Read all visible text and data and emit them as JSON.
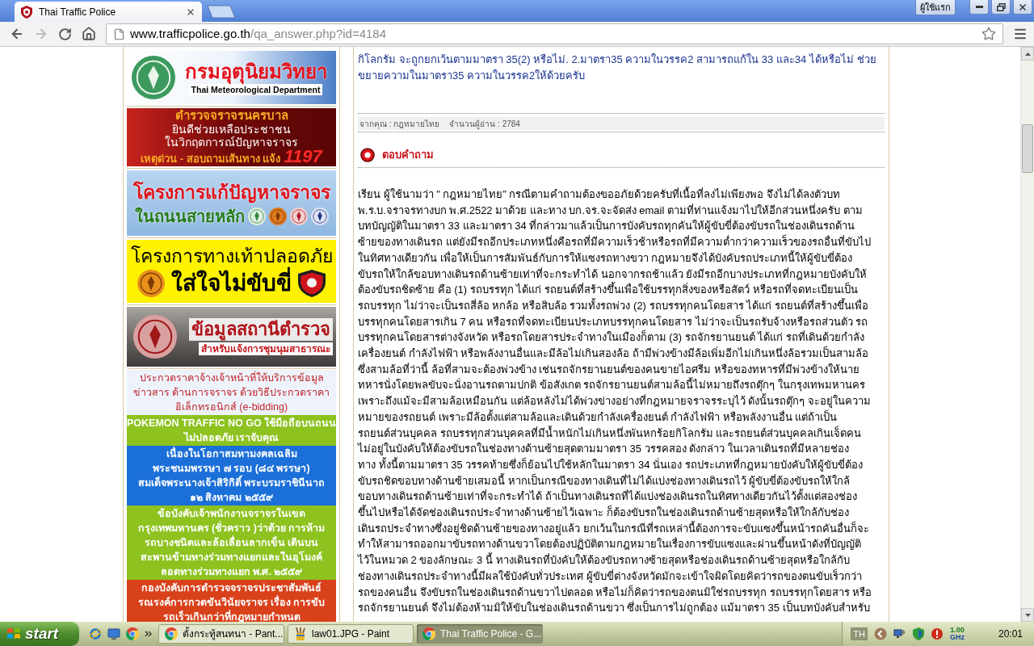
{
  "browser": {
    "tab_title": "Thai Traffic Police",
    "profile": "ผู้ใช้แรก",
    "url_host": "www.trafficpolice.go.th",
    "url_path": "/qa_answer.php?id=4184"
  },
  "sidebar": {
    "banners": [
      {
        "kind": "meteorology",
        "title": "กรมอุตุนิยมวิทยา",
        "subtitle": "Thai Meteorological Department"
      },
      {
        "kind": "hotline",
        "title": "ตำรวจจราจรนครบาล",
        "lines": [
          "ยินดีช่วยเหลือประชาชน",
          "ในวิกฤตการณ์ปัญหาจราจร"
        ],
        "call": "เหตุด่วน - สอบถามเส้นทาง แจ้ง",
        "number": "1197"
      },
      {
        "kind": "roads",
        "title": "โครงการแก้ปัญหาจราจร",
        "subtitle": "ในถนนสายหลัก"
      },
      {
        "kind": "sidewalk",
        "title": "โครงการทางเท้าปลอดภัย",
        "subtitle": "ใส่ใจไม่ขับขี่"
      },
      {
        "kind": "stations",
        "title": "ข้อมูลสถานีตำรวจ",
        "subtitle": "สำหรับแจ้งการชุมนุมสาธารณะ"
      }
    ],
    "links": [
      {
        "kind": "light",
        "color": "#eef3fb",
        "lines": [
          "ประกวดราคาจ้างเจ้าหน้าที่ให้บริการข้อมูล",
          "ข่าวสาร ด้านการจราจร ด้วยวิธีประกวดราคา",
          "อิเล็กทรอนิกส์ (e-bidding)"
        ]
      },
      {
        "kind": "solid",
        "color": "#8dc21f",
        "lines": [
          "POKEMON TRAFFIC NO GO ใช้มือถือบนถนน",
          "ไม่ปลอดภัย เราจับคุณ"
        ]
      },
      {
        "kind": "solid",
        "color": "#1b6fd8",
        "lines": [
          "เนื่องในโอกาสมหามงคลเฉลิม",
          "พระชนมพรรษา ๗ รอบ (๘๔ พรรษา)",
          "สมเด็จพระนางเจ้าสิริกิติ์ พระบรมราชินีนาถ",
          "๑๒ สิงหาคม ๒๕๕๙"
        ]
      },
      {
        "kind": "solid",
        "color": "#8dc21f",
        "lines": [
          "ข้อบังคับเจ้าพนักงานจราจรในเขต",
          "กรุงเทพมหานคร (ชั่วคราว )ว่าด้วย การห้าม",
          "รถบางชนิดและล้อเลื่อนลากเข็น เดินบน",
          "สะพานข้ามทางร่วมทางแยกและในอุโมงค์",
          "ลอดทางร่วมทางแยก พ.ศ. ๒๕๕๙"
        ]
      },
      {
        "kind": "solid",
        "color": "#d9411b",
        "lines": [
          "กองบังคับการตำรวจจราจรประชาสัมพันธ์",
          "รณรงค์การกวดขันวินัยจราจร เรื่อง การขับ",
          "รถเร็วเกินกว่าที่กฎหมายกำหนด"
        ]
      }
    ]
  },
  "question": {
    "lines": [
      "กิโลกรัม จะถูกยกเว้นตามมาตรา 35(2) หรือไม่. 2.มาตรา35 ความในวรรค2 สามารถแก้ใน 33 และ34 ได้หรือไม่ ช่วย",
      "ขยายความในมาตรา35 ความในวรรค2ให้ด้วยครับ"
    ]
  },
  "meta": {
    "author": "จากคุณ : กฎหมายไทย",
    "reads": "จำนวนผู้อ่าน : 2784"
  },
  "answer": {
    "heading": "ตอบคำถาม",
    "lines": [
      "เรียน ผู้ใช้นามว่า \" กฎหมายไทย” กรณีตามคำถามต้องขออภัยด้วยครับที่เนื้อที่ลงไม่เพียงพอ จึงไม่ได้ลงตัวบท",
      "พ.ร.บ.จราจรทางบก พ.ศ.2522 มาด้วย และทาง บก.จร.จะจัดส่ง email ตามที่ท่านแจ้งมาไปให้อีกส่วนหนึ่งครับ ตาม",
      "บทบัญญัติในมาตรา 33 และมาตรา 34 ที่กล่าวมาแล้วเป็นการบังคับรถทุกคันให้ผู้ขับขี่ต้องขับรถในช่องเดินรถด้าน",
      "ซ้ายของทางเดินรถ แต่ยังมีรถอีกประเภทหนึ่งคือรถที่มีความเร็วช้าหรือรถที่มีความต่ำกว่าความเร็วของรถอื่นที่ขับไป",
      "ในทิศทางเดียวกัน เพื่อให้เป็นการสัมพันธ์กับการให้แซงรถทางขวา กฎหมายจึงได้บังคับรถประเภทนี้ให้ผู้ขับขี่ต้อง",
      "ขับรถให้ใกล้ขอบทางเดินรถด้านซ้ายเท่าที่จะกระทำได้ นอกจากรถช้าแล้ว ยังมีรถอีกบางประเภทที่กฎหมายบังคับให้",
      "ต้องขับรถชิดซ้าย คือ (1) รถบรรทุก ได้แก่ รถยนต์ที่สร้างขึ้นเพื่อใช้บรรทุกสิ่งของหรือสัตว์ หรือรถที่จดทะเบียนเป็น",
      "รถบรรทุก ไม่ว่าจะเป็นรถสี่ล้อ หกล้อ หรือสิบล้อ รวมทั้งรถพ่วง (2) รถบรรทุกคนโดยสาร ได้แก่ รถยนต์ที่สร้างขึ้นเพื่อ",
      "บรรทุกคนโดยสารเกิน 7 คน หรือรถที่จดทะเบียนประเภทบรรทุกคนโดยสาร ไม่ว่าจะเป็นรถรับจ้างหรือรถส่วนตัว รถ",
      "บรรทุกคนโดยสารต่างจังหวัด หรือรถโดยสารประจำทางในเมืองก็ตาม (3) รถจักรยานยนต์ ได้แก่ รถที่เดินด้วยกำลัง",
      "เครื่องยนต์ กำลังไฟฟ้า หรือพลังงานอื่นและมีล้อไม่เกินสองล้อ ถ้ามีพ่วงข้างมีล้อเพิ่มอีกไม่เกินหนึ่งล้อรวมเป็นสามล้อ",
      "ซึ่งสามล้อที่ว่านี้ ล้อที่สามจะต้องพ่วงข้าง เช่นรถจักรยานยนต์ของคนขายไอศรีม หรือของทหารที่มีพ่วงข้างให้นาย",
      "ทหารนั่งโดยพลขับจะนั่งอานรถตามปกติ ข้อสังเกต รถจักรยานยนต์สามล้อนี้ไม่หมายถึงรถตุ๊กๆ ในกรุงเทพมหานคร",
      "เพราะถึงแม้จะมีสามล้อเหมือนกัน แต่ล้อหลังไม่ได้พ่วงข่างอย่างที่กฎหมายจราจรระบุไว้ ดังนั้นรถตุ๊กๆ จะอยู่ในความ",
      "หมายของรถยนต์ เพราะมีล้อตั้งแต่สามล้อและเดินด้วยกำลังเครื่องยนต์ กำลังไฟฟ้า หรือพลังงานอื่น แต่ถ้าเป็น",
      "รถยนต์ส่วนบุคคล รถบรรทุกส่วนบุคคลที่มีน้ำหนักไม่เกินหนึ่งพันหกร้อยกิโลกรัม และรถยนต์ส่วนบุคคลเกินเจ็ดคน",
      "ไม่อยู่ในบังคับให้ต้องขับรถในช่องทางด้านซ้ายสุดตามมาตรา 35 วรรคสอง ดังกล่าว ในเวลาเดินรถที่มีหลายช่อง",
      "ทาง ทั้งนี้ตามมาตรา 35 วรรคท้ายซึ่งก็ย้อนไปใช้หลักในมาตรา 34 นั่นเอง รถประเภทที่กฎหมายบังคับให้ผู้ขับขี่ต้อง",
      "ขับรถชิดขอบทางด้านซ้ายเสมอนี้ หากเป็นกรณีของทางเดินที่ไม่ได้แบ่งช่องทางเดินรถไว้ ผู้ขับขี่ต้องขับรถให้ใกล้",
      "ขอบทางเดินรถด้านซ้ายเท่าที่จะกระทำได้ ถ้าเป็นทางเดินรถที่ได้แบ่งช่องเดินรถในทิศทางเดียวกันไว้ตั้งแต่สองช่อง",
      "ขึ้นไปหรือได้จัดช่องเดินรถประจำทางด้านซ้ายไว้เฉพาะ ก็ต้องขับรถในช่องเดินรถด้านซ้ายสุดหรือให้ใกล้กับช่อง",
      "เดินรถประจำทางซึ่งอยู่ชิดด้านซ้ายของทางอยู่แล้ว ยกเว้นในกรณีที่รถเหล่านี้ต้องการจะขับแซงขึ้นหน้ารถคันอื่นก็จะ",
      "ทำให้สามารถออกมาขับรถทางด้านขวาโดยต้องปฏิบัติตามกฎหมายในเรื่องการขับแซงและผ่านขึ้นหน้าดังที่บัญญัติ",
      "ไว้ในหมวด 2 ของลักษณะ 3 นี้ ทางเดินรถที่บังคับให้ต้องขับรถทางซ้ายสุดหรือช่องเดินรถด้านซ้ายสุดหรือใกล้กับ",
      "ช่องทางเดินรถประจำทางนี้มีผลใช้บังคับทั่วประเทศ ผู้ขับขี่ต่างจังหวัดมักจะเข้าใจผิดโดยคิดว่ารถของตนขับเร็วกว่า",
      "รถของคนอื่น จึงขับรถในช่องเดินรถด้านขวาไปตลอด หรือไม่ก็คิดว่ารถของตนมิใช่รถบรรทุก รถบรรทุกโดยสาร หรือ",
      "รถจักรยานยนต์ จึงไม่ต้องห้ามมิให้ขับในช่องเดินรถด้านขวา ซึ่งเป็นการไม่ถูกต้อง แม้มาตรา 35 เป็นบทบังคับสำหรับ"
    ]
  },
  "taskbar": {
    "start": "start",
    "tasks": [
      {
        "kind": "browser",
        "label": "ตั้งกระทู้สนทนา - Pant...",
        "selected": false
      },
      {
        "kind": "paint",
        "label": "law01.JPG - Paint",
        "selected": false
      },
      {
        "kind": "browser",
        "label": "Thai Traffic Police - G...",
        "selected": true
      }
    ],
    "language": "TH",
    "cpu_speed": "1.00",
    "cpu_unit": "GHz",
    "clock": "20:01"
  }
}
